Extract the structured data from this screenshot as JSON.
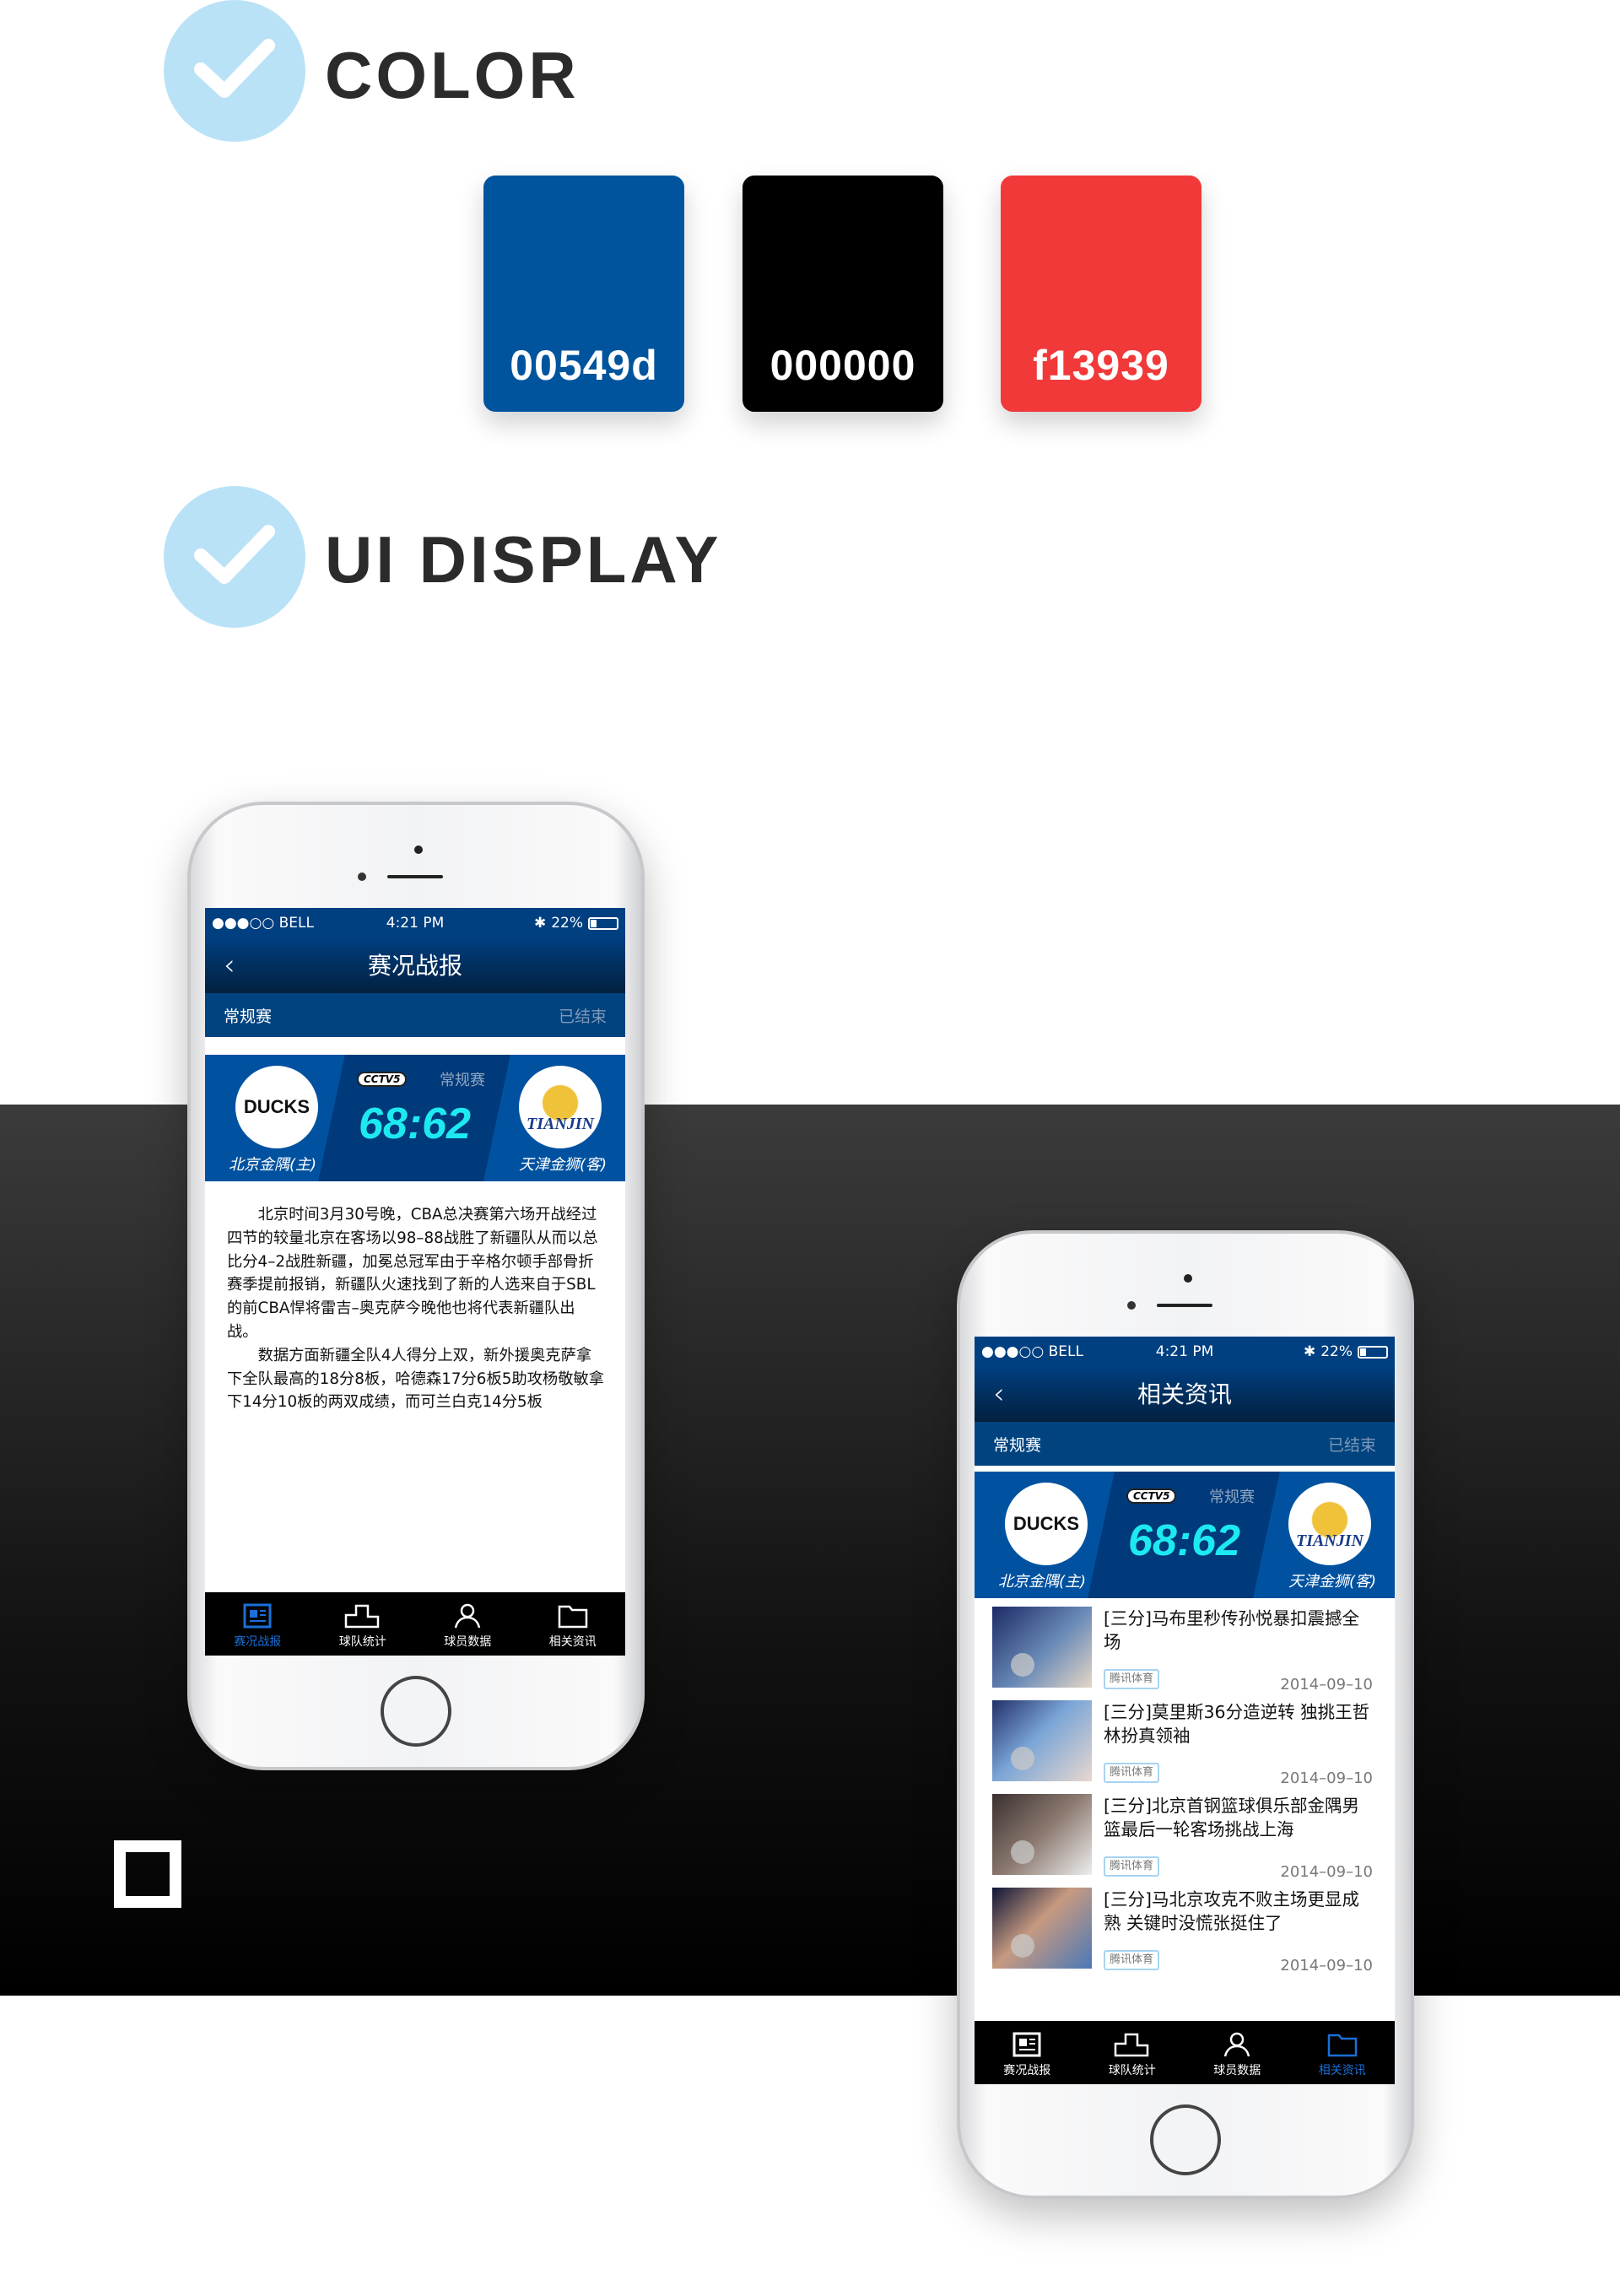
{
  "sections": {
    "color_title": "COLOR",
    "ui_title": "UI DISPLAY"
  },
  "swatches": [
    {
      "label": "00549d",
      "color": "#00549d"
    },
    {
      "label": "000000",
      "color": "#000000"
    },
    {
      "label": "f13939",
      "color": "#f13939"
    }
  ],
  "status": {
    "carrier": "●●●○○ BELL",
    "time": "4:21 PM",
    "battery": "22%"
  },
  "game": {
    "type": "常规赛",
    "state": "已结束",
    "channel": "CCTV5",
    "score": "68:62",
    "home": "北京金隅(主)",
    "away": "天津金狮(客)",
    "home_logo": "DUCKS",
    "away_logo": "TIANJIN"
  },
  "screen1": {
    "title": "赛况战报",
    "article": [
      "北京时间3月30号晚，CBA总决赛第六场开战经过四节的较量北京在客场以98–88战胜了新疆队从而以总比分4–2战胜新疆，加冕总冠军由于辛格尔顿手部骨折赛季提前报销，新疆队火速找到了新的人选来自于SBL的前CBA悍将雷吉–奥克萨今晚他也将代表新疆队出战。",
      "数据方面新疆全队4人得分上双，新外援奥克萨拿下全队最高的18分8板，哈德森17分6板5助攻杨敬敏拿下14分10板的两双成绩，而可兰白克14分5板"
    ]
  },
  "screen2": {
    "title": "相关资讯",
    "news": [
      {
        "title": "[三分]马布里秒传孙悦暴扣震撼全场",
        "source": "腾讯体育",
        "date": "2014–09–10"
      },
      {
        "title": "[三分]莫里斯36分造逆转 独挑王哲林扮真领袖",
        "source": "腾讯体育",
        "date": "2014–09–10"
      },
      {
        "title": "[三分]北京首钢篮球俱乐部金隅男篮最后一轮客场挑战上海",
        "source": "腾讯体育",
        "date": "2014–09–10"
      },
      {
        "title": "[三分]马北京攻克不败主场更显成熟 关键时没慌张挺住了",
        "source": "腾讯体育",
        "date": "2014–09–10"
      }
    ]
  },
  "tabs": [
    "赛况战报",
    "球队统计",
    "球员数据",
    "相关资讯"
  ],
  "colors": {
    "accent": "#00549d",
    "active_tab": "#1a6fd8",
    "score": "#1de9f0",
    "check": "#b9e2f7"
  }
}
